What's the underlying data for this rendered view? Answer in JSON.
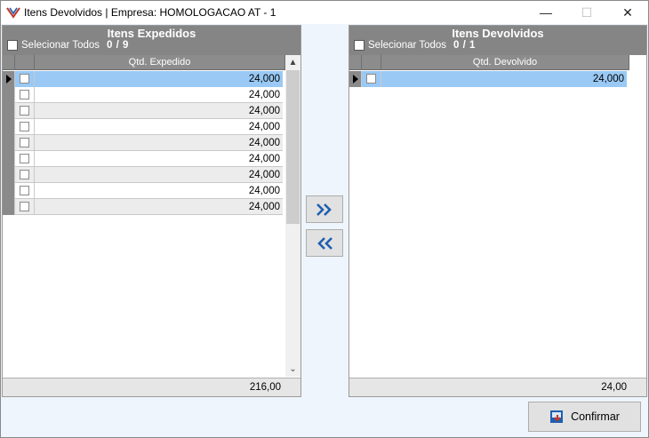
{
  "window": {
    "title": "Itens Devolvidos | Empresa: HOMOLOGACAO AT - 1",
    "controls": {
      "minimize": "—",
      "maximize": "☐",
      "close": "✕"
    }
  },
  "left_panel": {
    "title": "Itens Expedidos",
    "select_all_label": "Selecionar Todos",
    "count": "0 / 9",
    "column_header": "Qtd. Expedido",
    "rows": [
      "24,000",
      "24,000",
      "24,000",
      "24,000",
      "24,000",
      "24,000",
      "24,000",
      "24,000",
      "24,000"
    ],
    "total": "216,00"
  },
  "right_panel": {
    "title": "Itens Devolvidos",
    "select_all_label": "Selecionar Todos",
    "count": "0 / 1",
    "column_header": "Qtd. Devolvido",
    "rows": [
      "24,000"
    ],
    "total": "24,00"
  },
  "buttons": {
    "move_right_icon": "double-chevron-right-icon",
    "move_left_icon": "double-chevron-left-icon",
    "confirm_label": "Confirmar"
  },
  "colors": {
    "header_gray": "#858585",
    "selection_blue": "#99c9f4",
    "accent_blue": "#1f5fb0"
  }
}
